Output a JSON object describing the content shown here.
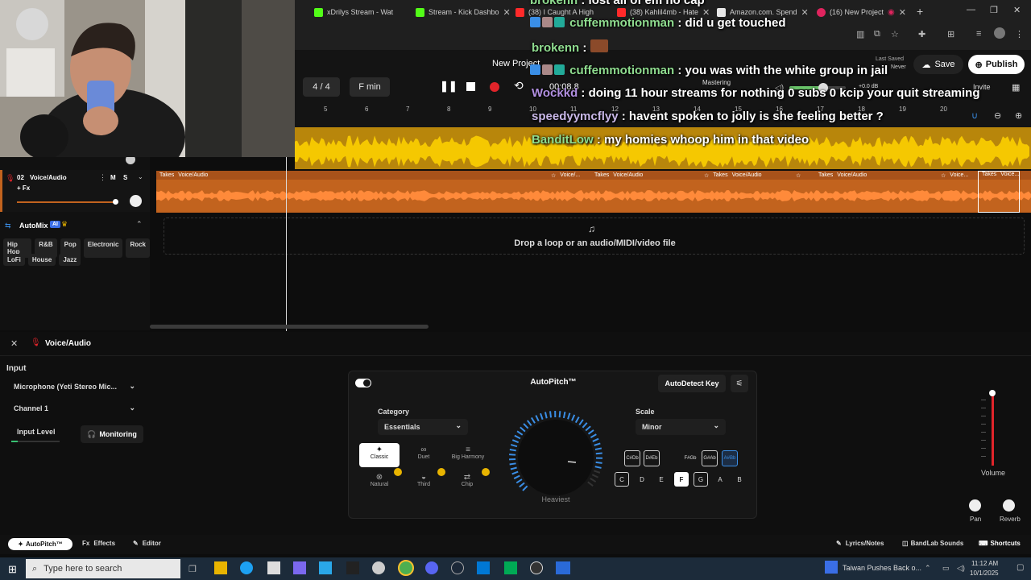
{
  "browser": {
    "tabs": [
      {
        "label": "xDrilys Stream - Wat",
        "color": "#53fc18"
      },
      {
        "label": "Stream - Kick Dashbo",
        "color": "#53fc18"
      },
      {
        "label": "(38) I Caught A High",
        "color": "#ff2a2a"
      },
      {
        "label": "(38) Kahlil4mb - Hate",
        "color": "#ff2a2a"
      },
      {
        "label": "Amazon.com. Spend",
        "color": "#e7e7e7"
      },
      {
        "label": "(16) New Project",
        "color": "#e0245e"
      }
    ],
    "new_tab": "+"
  },
  "toolbar": {
    "project_name": "New Project",
    "time_signature": "4 / 4",
    "key": "F min",
    "time": "00:08.8",
    "mastering": "Mastering",
    "db": "+0.0 dB",
    "last_saved_label": "Last Saved",
    "last_saved_value": "Never",
    "save": "Save",
    "publish": "Publish",
    "invite": "Invite"
  },
  "ruler": [
    "5",
    "6",
    "7",
    "8",
    "9",
    "10",
    "11",
    "12",
    "13",
    "14",
    "15",
    "16",
    "17",
    "18",
    "19",
    "20"
  ],
  "track2": {
    "number": "02",
    "name": "Voice/Audio",
    "fx": "+ Fx",
    "m": "M",
    "s": "S",
    "clips": [
      {
        "takes": "Takes",
        "name": "Voice/Audio"
      },
      {
        "takes": "",
        "name": "Voice/..."
      },
      {
        "takes": "Takes",
        "name": "Voice/Audio"
      },
      {
        "takes": "Takes",
        "name": "Voice/Audio"
      },
      {
        "takes": "",
        "name": ""
      },
      {
        "takes": "Takes",
        "name": "Voice/Audio"
      },
      {
        "takes": "",
        "name": "Voice..."
      },
      {
        "takes": "Takes",
        "name": "Voice..."
      }
    ]
  },
  "automix": {
    "label": "AutoMix",
    "ai": "AI",
    "genres_row1": [
      "Hip Hop",
      "R&B",
      "Pop",
      "Electronic",
      "Rock"
    ],
    "genres_row2": [
      "LoFi",
      "House",
      "Jazz"
    ]
  },
  "drop_zone": "Drop a loop or an audio/MIDI/video file",
  "panel": {
    "title": "Voice/Audio",
    "input_label": "Input",
    "input_device": "Microphone (Yeti Stereo Mic...",
    "channel": "Channel 1",
    "input_level": "Input Level",
    "monitoring": "Monitoring"
  },
  "autopitch": {
    "title": "AutoPitch™",
    "detect": "AutoDetect Key",
    "category_label": "Category",
    "category_value": "Essentials",
    "effects": [
      "Classic",
      "Duet",
      "Big Harmony",
      "Natural",
      "Third",
      "Chip"
    ],
    "knob_label": "Heaviest",
    "scale_label": "Scale",
    "scale_value": "Minor",
    "sharps": [
      [
        "C#",
        "Db"
      ],
      [
        "D#",
        "Eb"
      ],
      [
        "F#",
        "Gb"
      ],
      [
        "G#",
        "Ab"
      ],
      [
        "A#",
        "Bb"
      ]
    ],
    "naturals": [
      "C",
      "D",
      "E",
      "F",
      "G",
      "A",
      "B"
    ]
  },
  "mixer": {
    "volume": "Volume",
    "pan": "Pan",
    "reverb": "Reverb"
  },
  "bottom_bar": {
    "autopitch": "AutoPitch™",
    "effects": "Effects",
    "editor": "Editor",
    "fx_prefix": "Fx",
    "lyrics": "Lyrics/Notes",
    "sounds": "BandLab Sounds",
    "shortcuts": "Shortcuts"
  },
  "chat": [
    {
      "user": "brokenn",
      "msg": "lost all of em no cap"
    },
    {
      "user": "cuffemmotionman",
      "msg": "did u get touched"
    },
    {
      "user": "brokenn",
      "msg": ""
    },
    {
      "user": "cuffemmotionman",
      "msg": "you was with the white group in jail"
    },
    {
      "user": "Wockkd",
      "msg": "doing 11 hour streams for nothing 0 subs 0 kcip your quit streaming"
    },
    {
      "user": "speedyymcflyy",
      "msg": "havent spoken to jolly is she feeling better ?"
    },
    {
      "user": "BanditLow",
      "msg": "my homies whoop him in that video"
    }
  ],
  "taskbar": {
    "search": "Type here to search",
    "news": "Taiwan Pushes Back o...",
    "time": "11:12 AM",
    "date": "10/1/2025"
  },
  "colors": {
    "track1": "#b8860b",
    "track2": "#c2631e",
    "accent_blue": "#3a8ee6",
    "record_red": "#e0242a"
  }
}
